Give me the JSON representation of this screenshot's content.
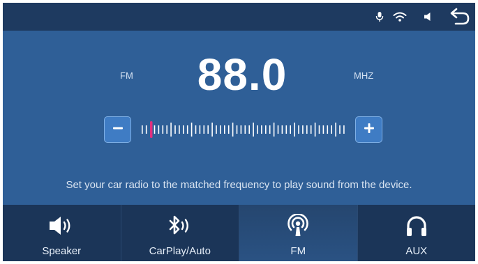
{
  "status_bar": {
    "icons": [
      "mic-icon",
      "wifi-icon",
      "volume-icon",
      "back-arrow-icon"
    ]
  },
  "radio": {
    "band": "FM",
    "frequency": "88.0",
    "unit": "MHZ",
    "decrease_icon": "minus-icon",
    "increase_icon": "plus-icon"
  },
  "hint": "Set your car radio to the matched frequency to play sound from the device.",
  "nav": {
    "items": [
      {
        "label": "Speaker",
        "icon": "speaker-icon"
      },
      {
        "label": "CarPlay/Auto",
        "icon": "bluetooth-audio-icon"
      },
      {
        "label": "FM",
        "icon": "broadcast-icon",
        "active": true
      },
      {
        "label": "AUX",
        "icon": "headphones-icon"
      }
    ]
  },
  "colors": {
    "background": "#2f5f97",
    "status_bar": "#1e3a60",
    "nav_bar": "#1b3558",
    "needle": "#e0307f",
    "button": "#3f7cc4"
  }
}
